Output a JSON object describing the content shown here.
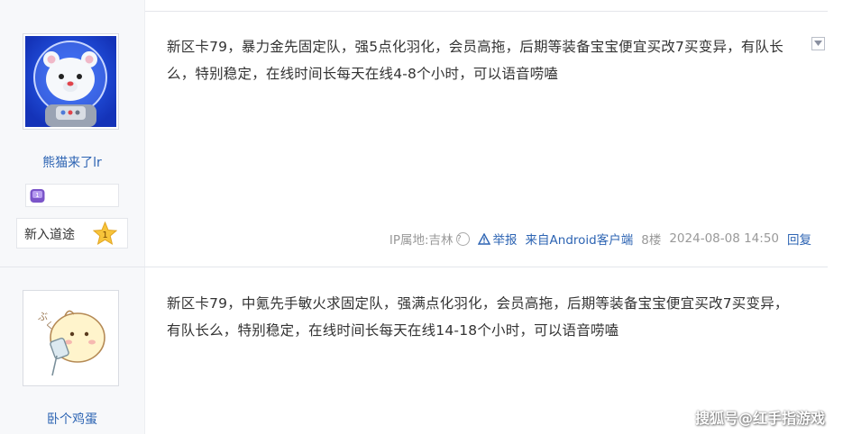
{
  "posts": [
    {
      "author": {
        "username": "熊猫来了lr",
        "badge_level": "1",
        "level_title": "新入道途",
        "level_number": "1"
      },
      "content": "新区卡79，暴力金先固定队，强5点化羽化，会员高拖，后期等装备宝宝便宜买改7买变异，有队长么，特别稳定，在线时间长每天在线4-8个小时，可以语音唠嗑",
      "meta": {
        "ip_label": "IP属地:吉林",
        "report_label": "举报",
        "source": "来自Android客户端",
        "floor": "8楼",
        "time": "2024-08-08 14:50",
        "reply_label": "回复"
      }
    },
    {
      "author": {
        "username": "卧个鸡蛋"
      },
      "content": "新区卡79，中氪先手敏火求固定队，强满点化羽化，会员高拖，后期等装备宝宝便宜买改7买变异，有队长么，特别稳定，在线时间长每天在线14-18个小时，可以语音唠嗑"
    }
  ],
  "watermark": "搜狐号@红手指游戏",
  "colors": {
    "link": "#2d64b3",
    "meta": "#999999",
    "sidebar": "#f7f8fa"
  },
  "icons": [
    "polar-bear-astronaut-avatar",
    "duck-drinking-avatar",
    "question-icon",
    "warning-icon",
    "star-level-icon",
    "collapse-arrow-icon"
  ]
}
